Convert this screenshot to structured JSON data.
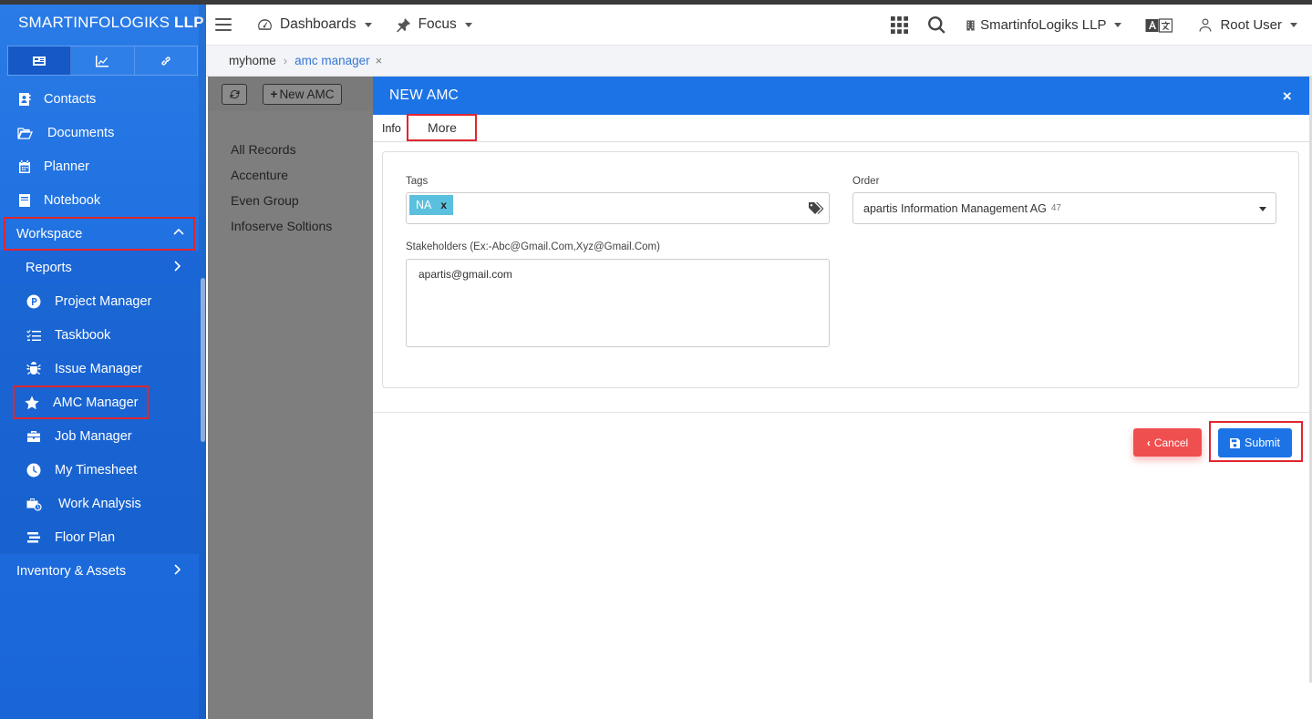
{
  "brand": {
    "name_part1": "SMARTINFOLOGIKS",
    "name_part2": "LLP"
  },
  "sidebar": {
    "tabs": [
      {
        "icon": "id-card-icon"
      },
      {
        "icon": "line-chart-icon"
      },
      {
        "icon": "link-icon"
      }
    ],
    "items": [
      {
        "label": "Contacts",
        "icon": "address-book-icon"
      },
      {
        "label": "Documents",
        "icon": "folder-open-icon"
      },
      {
        "label": "Planner",
        "icon": "calendar-icon"
      },
      {
        "label": "Notebook",
        "icon": "book-icon"
      },
      {
        "label": "Workspace",
        "icon": "",
        "expanded": true
      },
      {
        "label": "Reports",
        "icon": ""
      },
      {
        "label": "Project Manager",
        "icon": "project-p-icon"
      },
      {
        "label": "Taskbook",
        "icon": "tasks-icon"
      },
      {
        "label": "Issue Manager",
        "icon": "bug-icon"
      },
      {
        "label": "AMC Manager",
        "icon": "star-icon"
      },
      {
        "label": "Job Manager",
        "icon": "briefcase-icon"
      },
      {
        "label": "My Timesheet",
        "icon": "clock-icon"
      },
      {
        "label": "Work Analysis",
        "icon": "briefcase-clock-icon"
      },
      {
        "label": "Floor Plan",
        "icon": "floor-plan-icon"
      },
      {
        "label": "Inventory & Assets",
        "icon": ""
      }
    ]
  },
  "header": {
    "dashboards": "Dashboards",
    "focus": "Focus",
    "company": "SmartinfoLogiks LLP",
    "user": "Root User"
  },
  "breadcrumb": {
    "home": "myhome",
    "current": "amc manager",
    "close": "×"
  },
  "listpanel": {
    "new_button": "New AMC",
    "items": [
      "All Records",
      "Accenture",
      "Even Group",
      "Infoserve Soltions"
    ]
  },
  "modal": {
    "title": "NEW AMC",
    "close": "×",
    "tabs": {
      "info": "Info",
      "more": "More"
    },
    "fields": {
      "tags_label": "Tags",
      "tag_value": "NA",
      "tag_remove": "x",
      "order_label": "Order",
      "order_value": "apartis Information Management AG",
      "order_count": "47",
      "stakeholders_label": "Stakeholders (Ex:-Abc@Gmail.Com,Xyz@Gmail.Com)",
      "stakeholders_value": "apartis@gmail.com"
    },
    "buttons": {
      "cancel": "Cancel",
      "submit": "Submit"
    }
  },
  "colors": {
    "primary": "#1c73e6",
    "danger": "#ef4f4f",
    "highlight": "#e0262f",
    "tag": "#5bc0de"
  }
}
